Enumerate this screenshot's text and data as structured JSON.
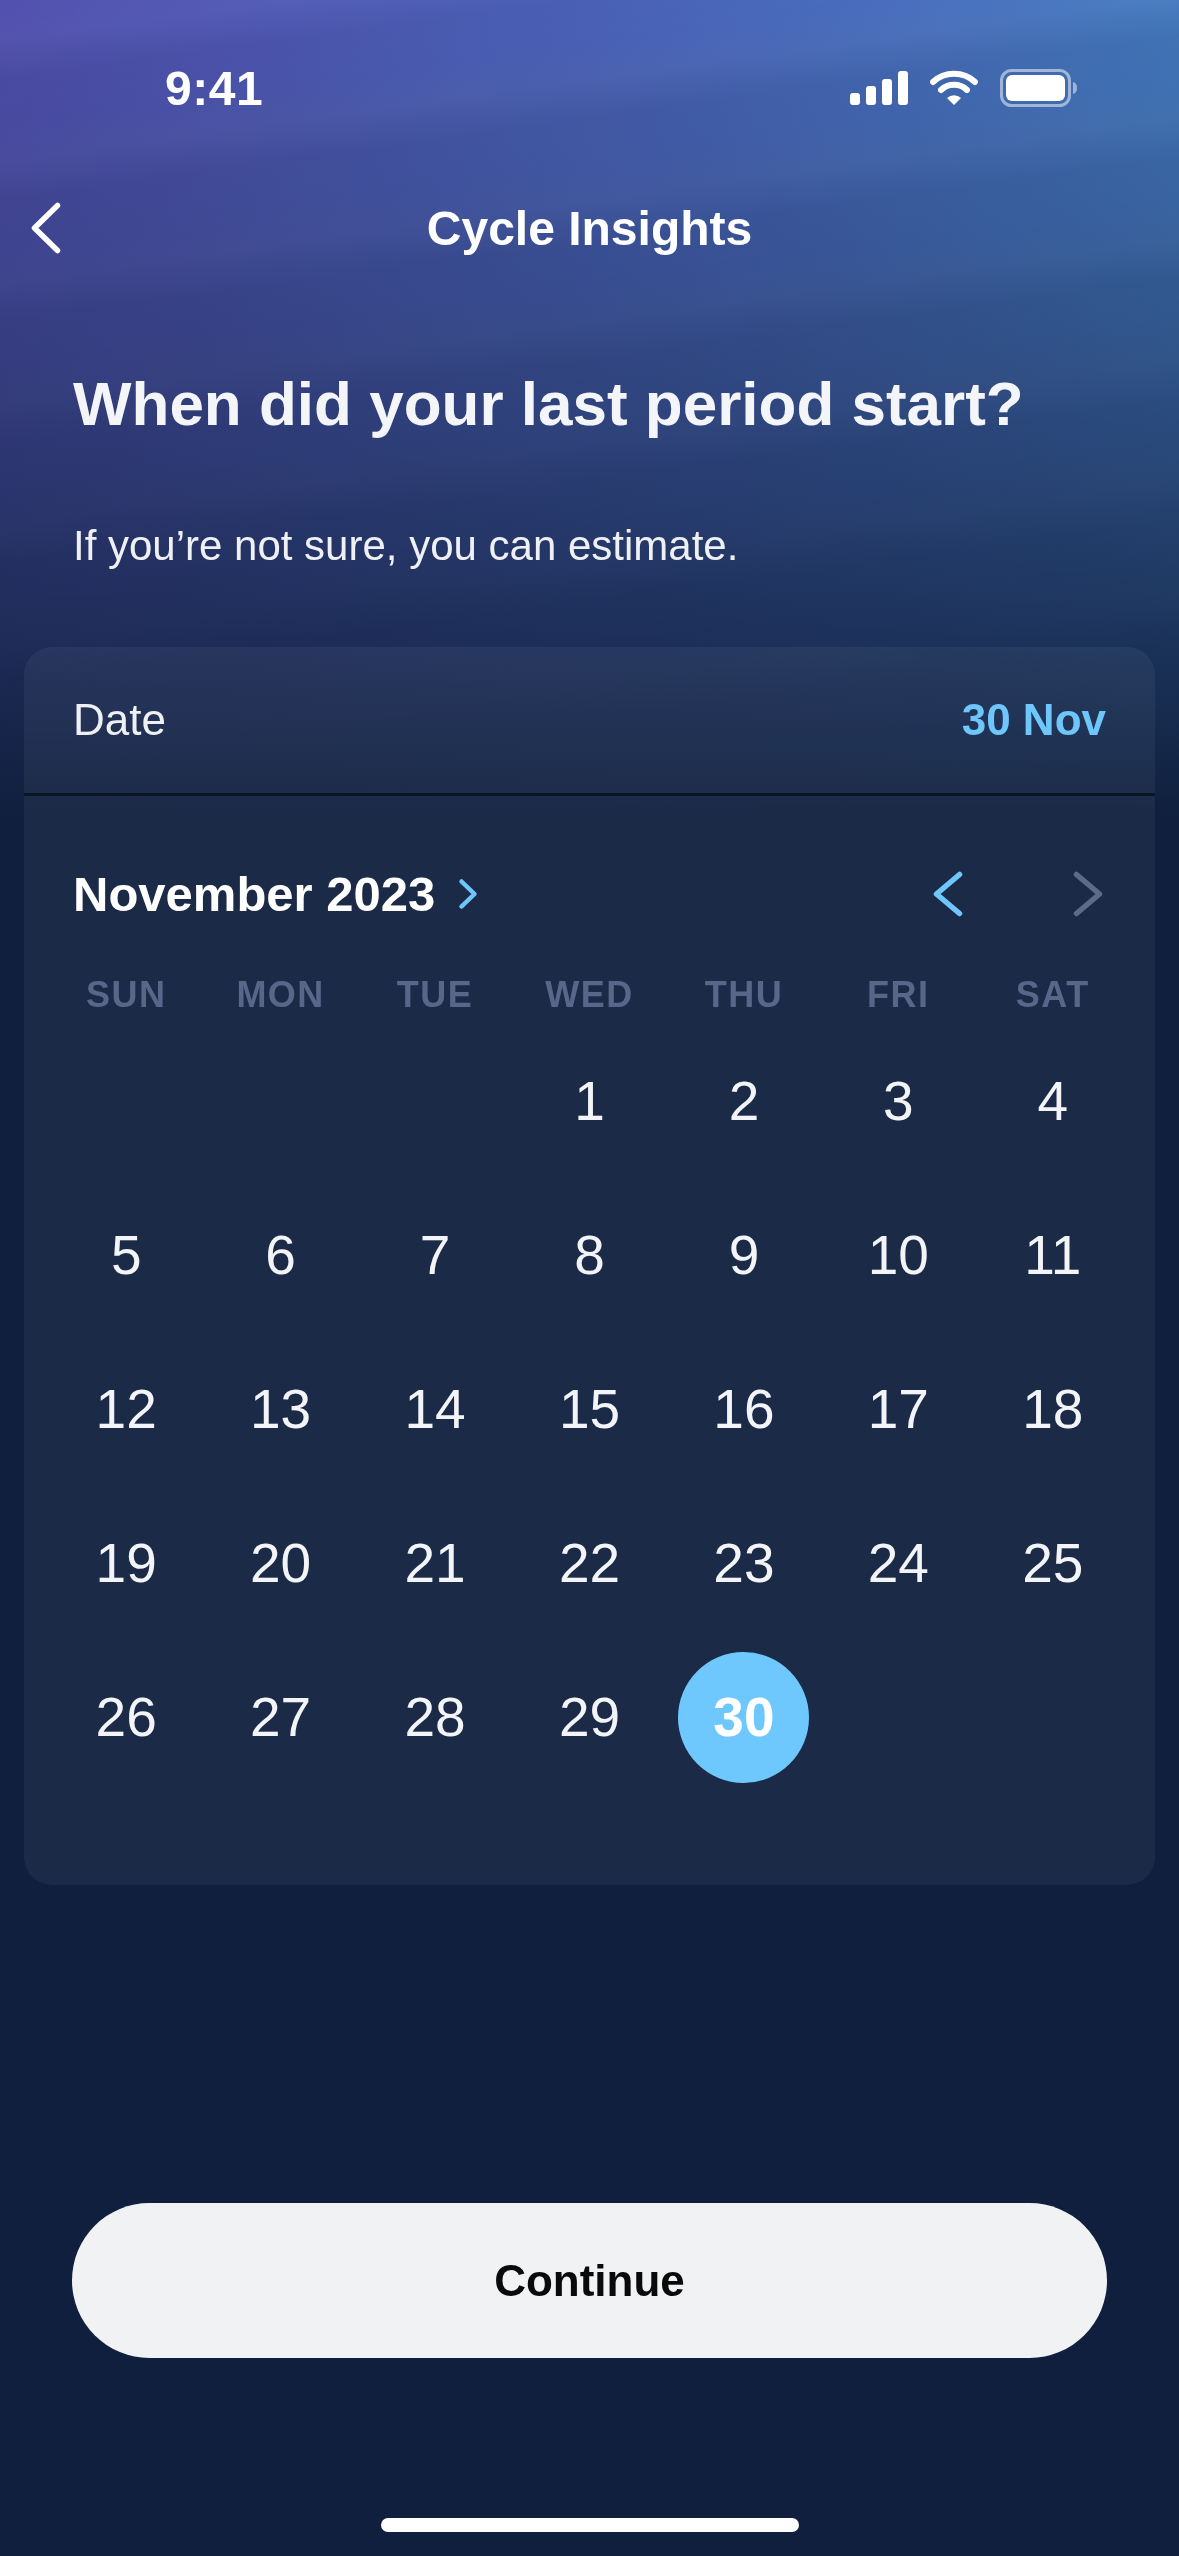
{
  "status_bar": {
    "time": "9:41"
  },
  "nav": {
    "title": "Cycle Insights"
  },
  "question": {
    "title": "When did your last period start?",
    "subtitle": "If you’re not sure, you can estimate."
  },
  "calendar": {
    "label": "Date",
    "value": "30 Nov",
    "month": "November 2023",
    "nav_buttons": [
      {
        "kind": "prev",
        "disabled": false
      },
      {
        "kind": "next",
        "disabled": true
      }
    ],
    "weekdays": [
      "SUN",
      "MON",
      "TUE",
      "WED",
      "THU",
      "FRI",
      "SAT"
    ],
    "weeks": [
      [
        {
          "kind": "empty"
        },
        {
          "kind": "empty"
        },
        {
          "kind": "empty"
        },
        {
          "kind": "day",
          "label": "1",
          "selected": false
        },
        {
          "kind": "day",
          "label": "2",
          "selected": false
        },
        {
          "kind": "day",
          "label": "3",
          "selected": false
        },
        {
          "kind": "day",
          "label": "4",
          "selected": false
        }
      ],
      [
        {
          "kind": "day",
          "label": "5",
          "selected": false
        },
        {
          "kind": "day",
          "label": "6",
          "selected": false
        },
        {
          "kind": "day",
          "label": "7",
          "selected": false
        },
        {
          "kind": "day",
          "label": "8",
          "selected": false
        },
        {
          "kind": "day",
          "label": "9",
          "selected": false
        },
        {
          "kind": "day",
          "label": "10",
          "selected": false
        },
        {
          "kind": "day",
          "label": "11",
          "selected": false
        }
      ],
      [
        {
          "kind": "day",
          "label": "12",
          "selected": false
        },
        {
          "kind": "day",
          "label": "13",
          "selected": false
        },
        {
          "kind": "day",
          "label": "14",
          "selected": false
        },
        {
          "kind": "day",
          "label": "15",
          "selected": false
        },
        {
          "kind": "day",
          "label": "16",
          "selected": false
        },
        {
          "kind": "day",
          "label": "17",
          "selected": false
        },
        {
          "kind": "day",
          "label": "18",
          "selected": false
        }
      ],
      [
        {
          "kind": "day",
          "label": "19",
          "selected": false
        },
        {
          "kind": "day",
          "label": "20",
          "selected": false
        },
        {
          "kind": "day",
          "label": "21",
          "selected": false
        },
        {
          "kind": "day",
          "label": "22",
          "selected": false
        },
        {
          "kind": "day",
          "label": "23",
          "selected": false
        },
        {
          "kind": "day",
          "label": "24",
          "selected": false
        },
        {
          "kind": "day",
          "label": "25",
          "selected": false
        }
      ],
      [
        {
          "kind": "day",
          "label": "26",
          "selected": false
        },
        {
          "kind": "day",
          "label": "27",
          "selected": false
        },
        {
          "kind": "day",
          "label": "28",
          "selected": false
        },
        {
          "kind": "day",
          "label": "29",
          "selected": false
        },
        {
          "kind": "day",
          "label": "30",
          "selected": true
        }
      ]
    ]
  },
  "button": {
    "label": "Continue"
  }
}
